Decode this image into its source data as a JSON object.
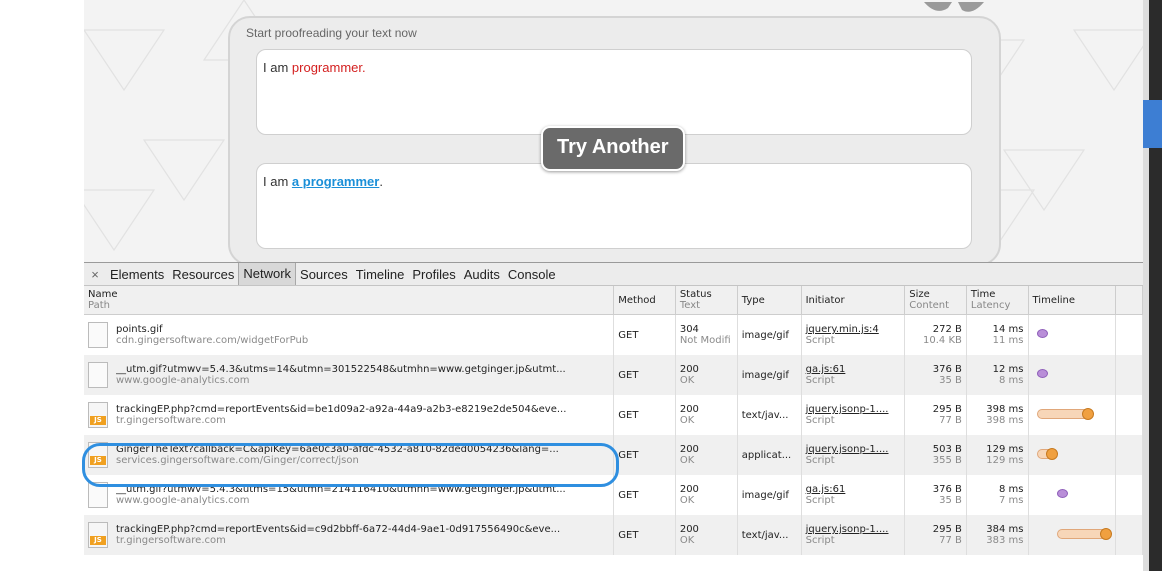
{
  "page": {
    "panel_label": "Start proofreading your text now",
    "input_prefix": "I am ",
    "input_error": "programmer.",
    "output_prefix": "I am ",
    "output_fix": "a programmer",
    "output_suffix": ".",
    "try_button": "Try Another"
  },
  "devtools": {
    "close_glyph": "×",
    "tabs": [
      "Elements",
      "Resources",
      "Network",
      "Sources",
      "Timeline",
      "Profiles",
      "Audits",
      "Console"
    ],
    "selected_tab": "Network",
    "columns": {
      "name": "Name",
      "path": "Path",
      "method": "Method",
      "status": "Status",
      "status_text": "Text",
      "type": "Type",
      "initiator": "Initiator",
      "size": "Size",
      "content": "Content",
      "time": "Time",
      "latency": "Latency",
      "timeline": "Timeline"
    },
    "rows": [
      {
        "name": "points.gif",
        "path": "cdn.gingersoftware.com/widgetForPub",
        "method": "GET",
        "status": "304",
        "status_text": "Not Modifi",
        "type": "image/gif",
        "initiator": "jquery.min.js:4",
        "initiator_type": "Script",
        "size": "272 B",
        "content": "10.4 KB",
        "time": "14 ms",
        "latency": "11 ms",
        "icon": "blank-file-icon"
      },
      {
        "name": "__utm.gif?utmwv=5.4.3&utms=14&utmn=301522548&utmhn=www.getginger.jp&utmt...",
        "path": "www.google-analytics.com",
        "method": "GET",
        "status": "200",
        "status_text": "OK",
        "type": "image/gif",
        "initiator": "ga.js:61",
        "initiator_type": "Script",
        "size": "376 B",
        "content": "35 B",
        "time": "12 ms",
        "latency": "8 ms",
        "icon": "blank-file-icon"
      },
      {
        "name": "trackingEP.php?cmd=reportEvents&id=be1d09a2-a92a-44a9-a2b3-e8219e2de504&eve...",
        "path": "tr.gingersoftware.com",
        "method": "GET",
        "status": "200",
        "status_text": "OK",
        "type": "text/jav...",
        "initiator": "jquery.jsonp-1....",
        "initiator_type": "Script",
        "size": "295 B",
        "content": "77 B",
        "time": "398 ms",
        "latency": "398 ms",
        "icon": "js-file-icon"
      },
      {
        "name": "GingerTheText?callback=C&apiKey=6ae0c3a0-afdc-4532-a810-82ded0054236&lang=...",
        "path": "services.gingersoftware.com/Ginger/correct/json",
        "method": "GET",
        "status": "200",
        "status_text": "OK",
        "type": "applicat...",
        "initiator": "jquery.jsonp-1....",
        "initiator_type": "Script",
        "size": "503 B",
        "content": "355 B",
        "time": "129 ms",
        "latency": "129 ms",
        "icon": "js-file-icon"
      },
      {
        "name": "__utm.gif?utmwv=5.4.3&utms=15&utmn=214116410&utmhn=www.getginger.jp&utmt...",
        "path": "www.google-analytics.com",
        "method": "GET",
        "status": "200",
        "status_text": "OK",
        "type": "image/gif",
        "initiator": "ga.js:61",
        "initiator_type": "Script",
        "size": "376 B",
        "content": "35 B",
        "time": "8 ms",
        "latency": "7 ms",
        "icon": "blank-file-icon"
      },
      {
        "name": "trackingEP.php?cmd=reportEvents&id=c9d2bbff-6a72-44d4-9ae1-0d917556490c&eve...",
        "path": "tr.gingersoftware.com",
        "method": "GET",
        "status": "200",
        "status_text": "OK",
        "type": "text/jav...",
        "initiator": "jquery.jsonp-1....",
        "initiator_type": "Script",
        "size": "295 B",
        "content": "77 B",
        "time": "384 ms",
        "latency": "383 ms",
        "icon": "js-file-icon"
      }
    ]
  },
  "colors": {
    "error_text": "#d42020",
    "correction_text": "#1a8fd8",
    "highlight_ring": "#2f8fe0"
  }
}
